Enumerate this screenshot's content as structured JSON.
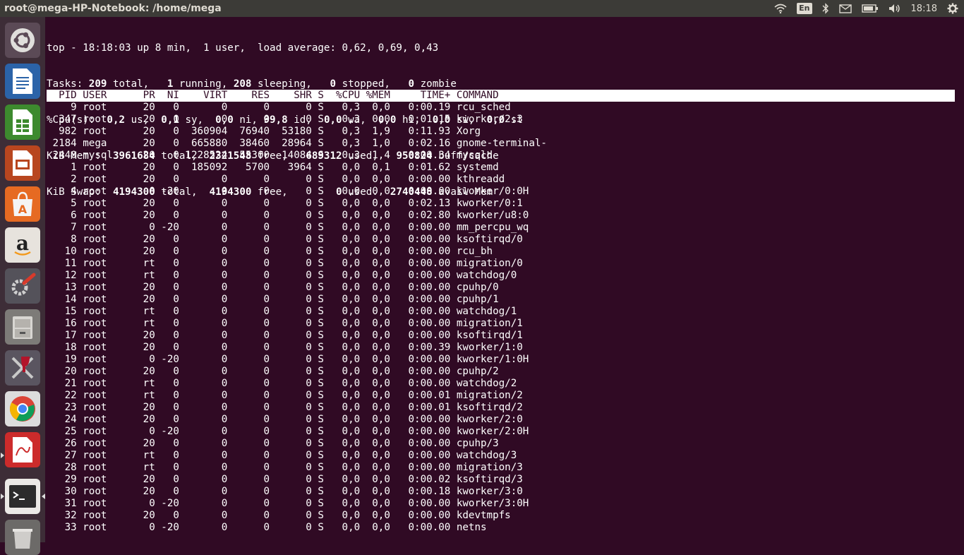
{
  "window": {
    "title": "root@mega-HP-Notebook: /home/mega"
  },
  "indicators": {
    "lang": "En",
    "clock": "18:18"
  },
  "launcher": {
    "items": [
      {
        "name": "ubuntu-dash-icon"
      },
      {
        "name": "libreoffice-writer-icon"
      },
      {
        "name": "libreoffice-calc-icon"
      },
      {
        "name": "libreoffice-impress-icon"
      },
      {
        "name": "ubuntu-software-icon"
      },
      {
        "name": "amazon-icon"
      },
      {
        "name": "system-settings-icon"
      },
      {
        "name": "files-cabinet-icon"
      },
      {
        "name": "wine-tools-icon"
      },
      {
        "name": "chrome-icon"
      },
      {
        "name": "document-viewer-icon"
      },
      {
        "name": "terminal-icon"
      },
      {
        "name": "trash-icon"
      }
    ]
  },
  "top": {
    "line1": "top - 18:18:03 up 8 min,  1 user,  load average: 0,62, 0,69, 0,43",
    "tasks": {
      "label": "Tasks:",
      "total": "209",
      "t_total": " total,   ",
      "running": "1",
      "t_running": " running, ",
      "sleeping": "208",
      "t_sleeping": " sleeping,   ",
      "stopped": "0",
      "t_stopped": " stopped,   ",
      "zombie": "0",
      "t_zombie": " zombie"
    },
    "cpu": {
      "label": "%Cpu(s):  ",
      "us": "0,2",
      "t_us": " us,  ",
      "sy": "0,1",
      "t_sy": " sy,  ",
      "ni": "0,0",
      "t_ni": " ni, ",
      "id": "99,8",
      "t_id": " id,  ",
      "wa": "0,0",
      "t_wa": " wa,  ",
      "hi": "0,0",
      "t_hi": " hi,  ",
      "si": "0,0",
      "t_si": " si,  ",
      "st": "0,0",
      "t_st": " st"
    },
    "mem": {
      "label": "KiB Mem :  ",
      "total": "3961684",
      "t_total": " total,  ",
      "free": "2321548",
      "t_free": " free,   ",
      "used": "689312",
      "t_used": " used,   ",
      "cache": "950824",
      "t_cache": " buff/cache"
    },
    "swap": {
      "label": "KiB Swap:  ",
      "total": "4194300",
      "t_total": " total,  ",
      "free": "4194300",
      "t_free": " free,        ",
      "used": "0",
      "t_used": " used.  ",
      "avail": "2740448",
      "t_avail": " avail Mem"
    },
    "header": "  PID USER      PR  NI    VIRT    RES    SHR S  %CPU %MEM     TIME+ COMMAND",
    "processes": [
      "    9 root      20   0       0      0      0 S   0,3  0,0   0:00.19 rcu_sched",
      "  347 root      20   0       0      0      0 S   0,3  0,0   0:01.15 kworker/2:3",
      "  982 root      20   0  360904  76940  53180 S   0,3  1,9   0:11.93 Xorg",
      " 2184 mega      20   0  665880  38460  28964 S   0,3  1,0   0:02.16 gnome-terminal-",
      " 2440 mysql     20   0 1228524  55300  14084 S   0,3  1,4   0:00.34 mysqld",
      "    1 root      20   0  185092   5700   3964 S   0,0  0,1   0:01.62 systemd",
      "    2 root      20   0       0      0      0 S   0,0  0,0   0:00.00 kthreadd",
      "    4 root       0 -20       0      0      0 S   0,0  0,0   0:00.00 kworker/0:0H",
      "    5 root      20   0       0      0      0 S   0,0  0,0   0:02.13 kworker/0:1",
      "    6 root      20   0       0      0      0 S   0,0  0,0   0:02.80 kworker/u8:0",
      "    7 root       0 -20       0      0      0 S   0,0  0,0   0:00.00 mm_percpu_wq",
      "    8 root      20   0       0      0      0 S   0,0  0,0   0:00.00 ksoftirqd/0",
      "   10 root      20   0       0      0      0 S   0,0  0,0   0:00.00 rcu_bh",
      "   11 root      rt   0       0      0      0 S   0,0  0,0   0:00.00 migration/0",
      "   12 root      rt   0       0      0      0 S   0,0  0,0   0:00.00 watchdog/0",
      "   13 root      20   0       0      0      0 S   0,0  0,0   0:00.00 cpuhp/0",
      "   14 root      20   0       0      0      0 S   0,0  0,0   0:00.00 cpuhp/1",
      "   15 root      rt   0       0      0      0 S   0,0  0,0   0:00.00 watchdog/1",
      "   16 root      rt   0       0      0      0 S   0,0  0,0   0:00.00 migration/1",
      "   17 root      20   0       0      0      0 S   0,0  0,0   0:00.00 ksoftirqd/1",
      "   18 root      20   0       0      0      0 S   0,0  0,0   0:00.39 kworker/1:0",
      "   19 root       0 -20       0      0      0 S   0,0  0,0   0:00.00 kworker/1:0H",
      "   20 root      20   0       0      0      0 S   0,0  0,0   0:00.00 cpuhp/2",
      "   21 root      rt   0       0      0      0 S   0,0  0,0   0:00.00 watchdog/2",
      "   22 root      rt   0       0      0      0 S   0,0  0,0   0:00.01 migration/2",
      "   23 root      20   0       0      0      0 S   0,0  0,0   0:00.01 ksoftirqd/2",
      "   24 root      20   0       0      0      0 S   0,0  0,0   0:00.00 kworker/2:0",
      "   25 root       0 -20       0      0      0 S   0,0  0,0   0:00.00 kworker/2:0H",
      "   26 root      20   0       0      0      0 S   0,0  0,0   0:00.00 cpuhp/3",
      "   27 root      rt   0       0      0      0 S   0,0  0,0   0:00.00 watchdog/3",
      "   28 root      rt   0       0      0      0 S   0,0  0,0   0:00.00 migration/3",
      "   29 root      20   0       0      0      0 S   0,0  0,0   0:00.02 ksoftirqd/3",
      "   30 root      20   0       0      0      0 S   0,0  0,0   0:00.18 kworker/3:0",
      "   31 root       0 -20       0      0      0 S   0,0  0,0   0:00.00 kworker/3:0H",
      "   32 root      20   0       0      0      0 S   0,0  0,0   0:00.00 kdevtmpfs",
      "   33 root       0 -20       0      0      0 S   0,0  0,0   0:00.00 netns"
    ]
  }
}
